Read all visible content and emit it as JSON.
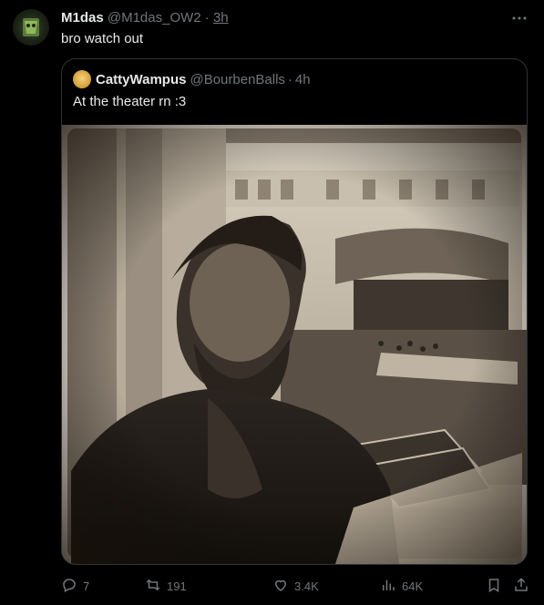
{
  "tweet": {
    "author_name": "M1das",
    "author_handle": "@M1das_OW2",
    "separator": "·",
    "time": "3h",
    "text": "bro watch out"
  },
  "quote": {
    "author_name": "CattyWampus",
    "author_handle": "@BourbenBalls",
    "separator": "·",
    "time": "4h",
    "text": "At the theater rn :3"
  },
  "actions": {
    "replies": "7",
    "reposts": "191",
    "likes": "3.4K",
    "views": "64K"
  },
  "colors": {
    "background": "#000000",
    "primary_text": "#e7e9ea",
    "secondary_text": "#71767b",
    "border": "#2f3336"
  },
  "icons": [
    "more-icon",
    "reply-icon",
    "retweet-icon",
    "like-icon",
    "views-icon",
    "bookmark-icon",
    "share-icon"
  ]
}
